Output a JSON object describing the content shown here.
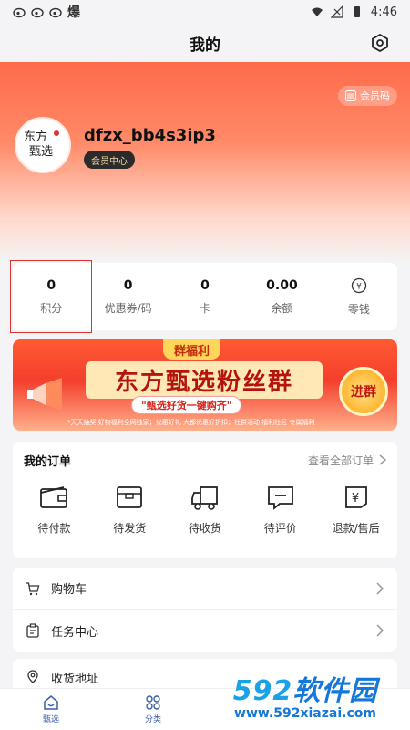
{
  "status_bar": {
    "time": "4:46",
    "notify_text": "爆"
  },
  "header": {
    "title": "我的",
    "member_code_label": "会员码"
  },
  "profile": {
    "username": "dfzx_bb4s3ip3",
    "member_center_label": "会员中心"
  },
  "stats": [
    {
      "value": "0",
      "label": "积分"
    },
    {
      "value": "0",
      "label": "优惠券/码"
    },
    {
      "value": "0",
      "label": "卡"
    },
    {
      "value": "0.00",
      "label": "余额"
    },
    {
      "value": "",
      "label": "零钱"
    }
  ],
  "banner": {
    "tag": "群福利",
    "headline": "东方甄选粉丝群",
    "slogan": "\"甄选好货一键购齐\"",
    "note": "*天天抽奖 好物福利全网独家；优惠好礼 大都优惠好折扣；社群活动 福利社区 专属福利",
    "join_label": "进群"
  },
  "orders": {
    "title": "我的订单",
    "view_all_label": "查看全部订单",
    "items": [
      {
        "label": "待付款",
        "icon": "wallet-icon"
      },
      {
        "label": "待发货",
        "icon": "box-icon"
      },
      {
        "label": "待收货",
        "icon": "truck-icon"
      },
      {
        "label": "待评价",
        "icon": "comment-icon"
      },
      {
        "label": "退款/售后",
        "icon": "refund-icon"
      }
    ]
  },
  "menu": [
    {
      "label": "购物车",
      "icon": "cart-icon"
    },
    {
      "label": "任务中心",
      "icon": "task-icon"
    },
    {
      "label": "收货地址",
      "icon": "location-icon"
    }
  ],
  "tabbar": [
    {
      "label": "甄选",
      "icon": "home-icon"
    },
    {
      "label": "分类",
      "icon": "category-icon"
    }
  ],
  "watermark": {
    "brand_digits": "592",
    "brand_cn": "软件园",
    "url": "www.592xiazai.com"
  },
  "colors": {
    "accent": "#ff6b4a",
    "tab_active": "#3b5fa8",
    "watermark": "#1477d9"
  }
}
